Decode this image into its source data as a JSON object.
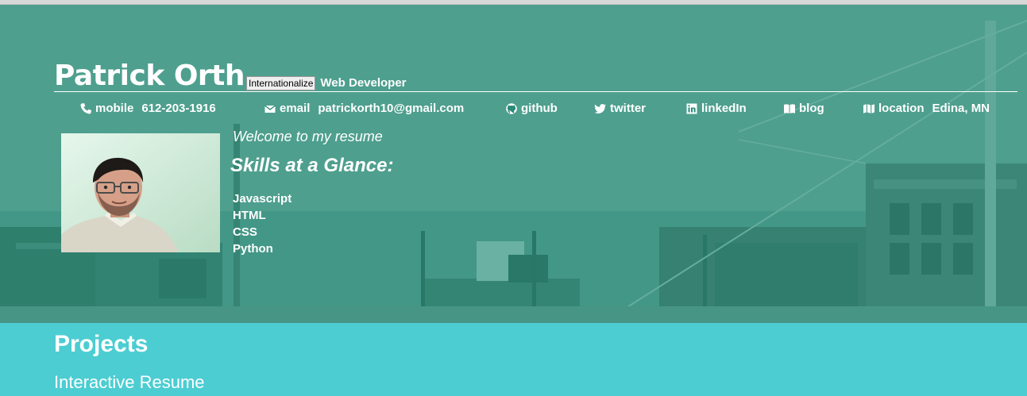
{
  "header": {
    "name": "Patrick Orth",
    "internationalize_label": "Internationalize",
    "role": "Web Developer"
  },
  "contacts": [
    {
      "id": "mobile",
      "icon": "phone-icon",
      "label": "mobile",
      "value": "612-203-1916"
    },
    {
      "id": "email",
      "icon": "mail-icon",
      "label": "email",
      "value": "patrickorth10@gmail.com"
    },
    {
      "id": "github",
      "icon": "github-icon",
      "label": "github",
      "value": ""
    },
    {
      "id": "twitter",
      "icon": "twitter-icon",
      "label": "twitter",
      "value": ""
    },
    {
      "id": "linkedin",
      "icon": "linkedin-icon",
      "label": "linkedIn",
      "value": ""
    },
    {
      "id": "blog",
      "icon": "book-icon",
      "label": "blog",
      "value": ""
    },
    {
      "id": "location",
      "icon": "map-icon",
      "label": "location",
      "value": "Edina, MN"
    }
  ],
  "bio": {
    "welcome": "Welcome to my resume",
    "skills_title": "Skills at a Glance:",
    "skills": [
      "Javascript",
      "HTML",
      "CSS",
      "Python"
    ]
  },
  "projects": {
    "title": "Projects",
    "items": [
      "Interactive Resume"
    ]
  },
  "colors": {
    "header_overlay": "#1e8c78",
    "projects_bg": "#4ccdd2",
    "text": "#ffffff"
  }
}
